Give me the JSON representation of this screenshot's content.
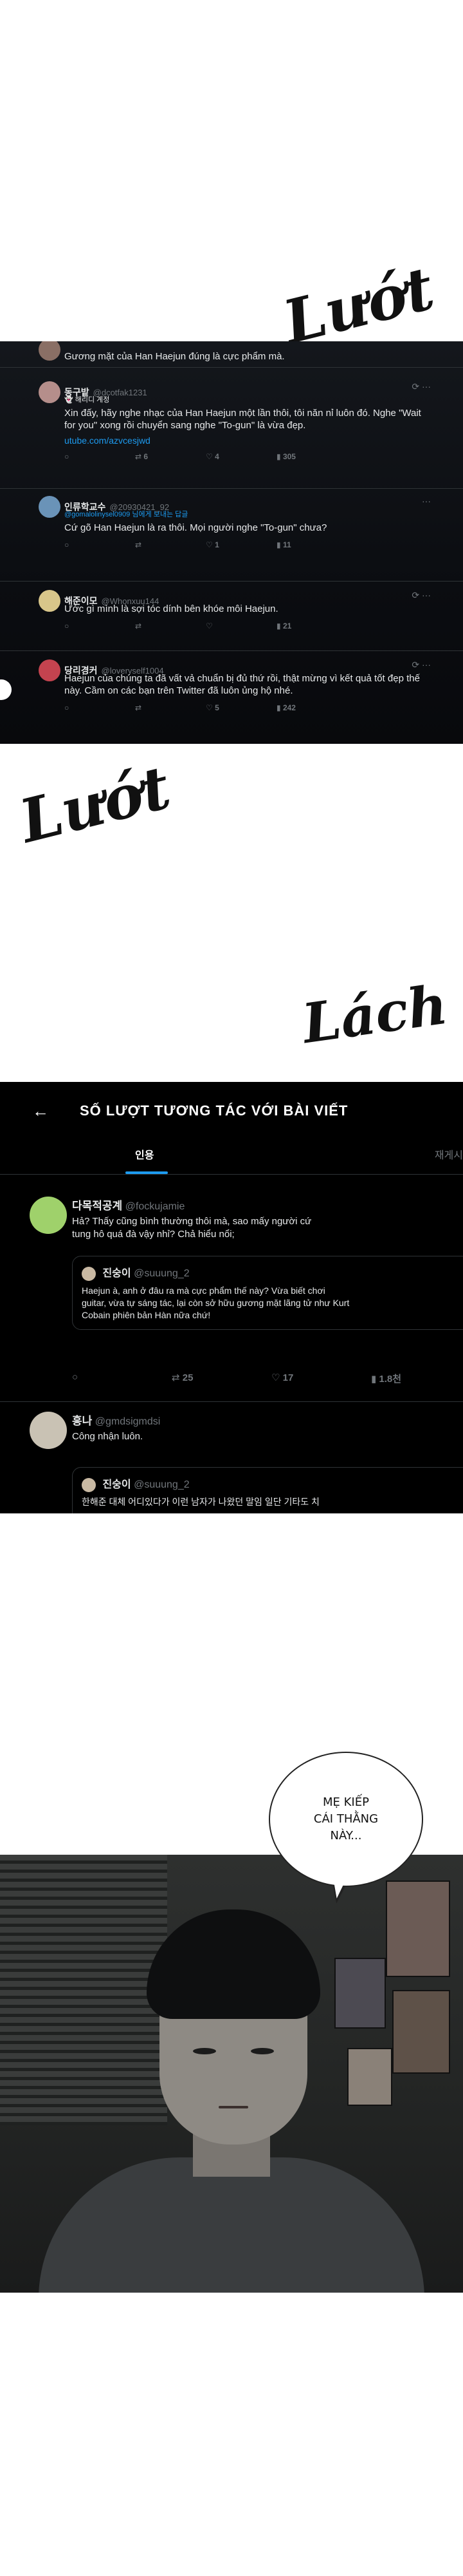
{
  "sfx": {
    "top": "Lướt",
    "middle": "Lướt",
    "right": "Lách"
  },
  "panel1": {
    "tweets": [
      {
        "name": "",
        "handle": "",
        "body": "Gương mặt của Han Haejun đúng là cực phẩm mà.",
        "avatar_color": "#8a6f65"
      },
      {
        "name": "동구밭",
        "handle": "@dcotfak1231",
        "sub": "👻 해리디 계정",
        "body": "Xin đấy, hãy nghe nhạc của Han Haejun một lần thôi, tôi năn nỉ luôn đó. Nghe \"Wait for you\" xong rồi chuyển sang nghe \"To-gun\" là vừa đẹp.",
        "link": "utube.com/azvcesjwd",
        "actions": [
          "",
          "6",
          "4",
          "305"
        ],
        "avatar_color": "#b58e8b"
      },
      {
        "name": "인류학교수",
        "handle": "@20930421_92",
        "sub": "@gomalolinysel0909 님에게 보내는 답글",
        "body": "Cứ gõ Han Haejun là ra thôi. Mọi người nghe \"To-gun\" chưa?",
        "actions": [
          "",
          "",
          "1",
          "11"
        ],
        "avatar_color": "#6a93b8"
      },
      {
        "name": "해준이모",
        "handle": "@Whonxuu144",
        "body": "Ước gì mình là sợi tóc dính bên khóe môi Haejun.",
        "actions": [
          "",
          "",
          "",
          "21"
        ],
        "avatar_color": "#d8c68a"
      },
      {
        "name": "당리경커",
        "handle": "@loveryself1004",
        "body": "Haejun của chúng ta đã vất vả chuẩn bị đủ thứ rồi, thật mừng vì kết quả tốt đẹp thế này. Cầm on các bạn trên Twitter đã luôn ủng hộ nhé.",
        "actions": [
          "",
          "",
          "5",
          "242"
        ],
        "avatar_color": "#c4434f"
      }
    ]
  },
  "panel2": {
    "title": "SỐ LƯỢT TƯƠNG TÁC VỚI BÀI VIẾT",
    "tab_active": "인용",
    "tab_right": "재게시",
    "quotes": [
      {
        "name": "다목적공계",
        "handle": "@fockujamie",
        "body": "Hả? Thấy cũng bình thường thôi mà, sao mấy người cứ tung hô quá đà vậy nhỉ? Chả hiểu nổi;",
        "avatar_color": "#9fd16b",
        "quote": {
          "name": "진숭이",
          "handle": "@suuung_2",
          "body": "Haejun à, anh ở đâu ra mà cực phẩm thế này? Vừa biết chơi guitar, vừa tự sáng tác, lại còn sở hữu gương mặt lãng tử như Kurt Cobain phiên bản Hàn nữa chứ!"
        },
        "actions": [
          "",
          "25",
          "17",
          "1.8천"
        ]
      },
      {
        "name": "흥나",
        "handle": "@gmdsigmdsi",
        "body": "Công nhận luôn.",
        "avatar_color": "#c9c2b4",
        "quote": {
          "name": "진숭이",
          "handle": "@suuung_2",
          "body": "한해준 대체 어디있다가 이런 남자가 나왔던 말임 일단 기타도 치"
        }
      }
    ]
  },
  "panel3": {
    "bubble": "MẸ KIẾP\nCÁI THẰNG\nNÀY..."
  }
}
